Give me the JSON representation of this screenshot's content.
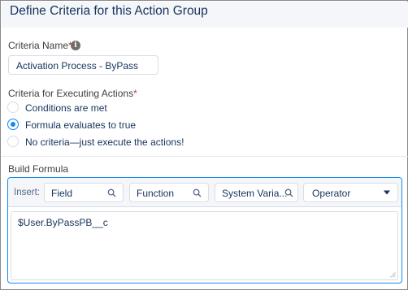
{
  "header": {
    "title": "Define Criteria for this Action Group"
  },
  "criteria_name": {
    "label": "Criteria Name",
    "required_marker": "*",
    "info_icon": "info-icon",
    "value": "Activation Process - ByPass"
  },
  "executing_actions": {
    "label": "Criteria for Executing Actions",
    "required_marker": "*",
    "options": [
      {
        "label": "Conditions are met",
        "selected": false
      },
      {
        "label": "Formula evaluates to true",
        "selected": true
      },
      {
        "label": "No criteria—just execute the actions!",
        "selected": false
      }
    ]
  },
  "build_formula": {
    "label": "Build Formula",
    "insert_label": "Insert:",
    "field": {
      "label": "Field",
      "icon": "search-icon"
    },
    "function": {
      "label": "Function",
      "icon": "search-icon"
    },
    "system_variables": {
      "label": "System Varia...",
      "icon": "search-icon"
    },
    "operator": {
      "label": "Operator",
      "icon": "dropdown-arrow-icon"
    },
    "formula_text": "$User.ByPassPB__c"
  },
  "colors": {
    "accent": "#1589ee",
    "required": "#c23934",
    "text": "#16325c"
  }
}
